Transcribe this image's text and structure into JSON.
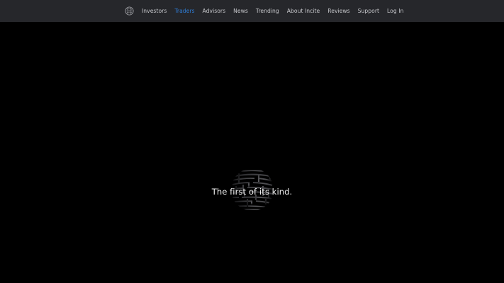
{
  "nav": {
    "links": [
      {
        "label": "Investors"
      },
      {
        "label": "Traders"
      },
      {
        "label": "Advisors"
      },
      {
        "label": "News"
      },
      {
        "label": "Trending"
      },
      {
        "label": "About Incite"
      },
      {
        "label": "Reviews"
      },
      {
        "label": "Support"
      },
      {
        "label": "Log In"
      }
    ],
    "active_color": "#2f7ed8",
    "logo_icon": "globe-icon"
  },
  "hero": {
    "tagline": "The first of its kind.",
    "graphic_icon": "maze-globe-icon"
  },
  "colors": {
    "navbar_bg": "#26272b",
    "page_bg": "#000000",
    "link": "#c7c8cc",
    "tagline": "#f2f2f2"
  }
}
